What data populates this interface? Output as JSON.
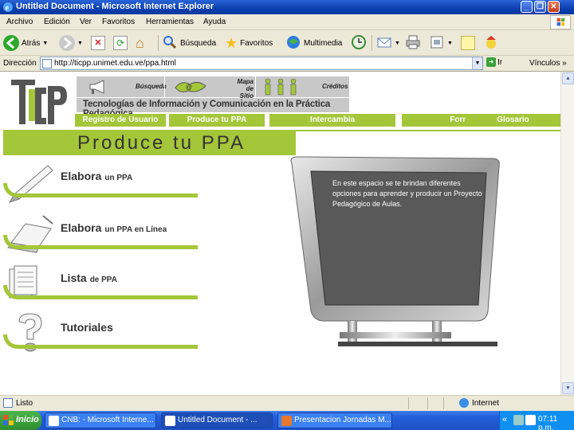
{
  "window": {
    "title": "Untitled Document - Microsoft Internet Explorer"
  },
  "menubar": {
    "items": [
      "Archivo",
      "Edición",
      "Ver",
      "Favoritos",
      "Herramientas",
      "Ayuda"
    ]
  },
  "toolbar": {
    "back_label": "Atrás",
    "search_label": "Búsqueda",
    "favorites_label": "Favoritos",
    "multimedia_label": "Multimedia"
  },
  "addressbar": {
    "label": "Dirección",
    "url": "http://ticpp.unimet.edu.ve/ppa.html",
    "go_label": "Ir",
    "links_label": "Vínculos"
  },
  "site": {
    "logo_text": "TICPP",
    "header": {
      "search": "Búsqueda",
      "sitemap_line1": "Mapa",
      "sitemap_line2": "de Sitio",
      "credits": "Créditos",
      "title": "Tecnologías de Información y Comunicación en la Práctica Pedagógica"
    },
    "nav": [
      "Registro de Usuario",
      "Produce tu PPA",
      "Intercambia",
      "Formate",
      "Glosario"
    ],
    "banner_title": "Produce tu PPA",
    "menu": [
      {
        "big": "Elabora",
        "small": "un PPA",
        "icon": "pen-icon"
      },
      {
        "big": "Elabora",
        "small": "un PPA en Línea",
        "icon": "laptop-icon"
      },
      {
        "big": "Lista",
        "small": "de PPA",
        "icon": "documents-icon"
      },
      {
        "big": "Tutoriales",
        "small": "",
        "icon": "question-icon"
      }
    ],
    "monitor_text": "En este espacio se te brindan diferentes opciones para aprender y producir un Proyecto Pedagógico de Aulas."
  },
  "statusbar": {
    "status": "Listo",
    "zone": "Internet"
  },
  "taskbar": {
    "start_label": "Inicio",
    "tasks": [
      "CNB: - Microsoft Interne...",
      "Untitled Document - ...",
      "Presentacion Jornadas M..."
    ],
    "clock": "07:11 p.m."
  },
  "colors": {
    "accent_green": "#a4c639",
    "title_blue": "#0b3fae",
    "header_grey": "#c8c8c8"
  }
}
